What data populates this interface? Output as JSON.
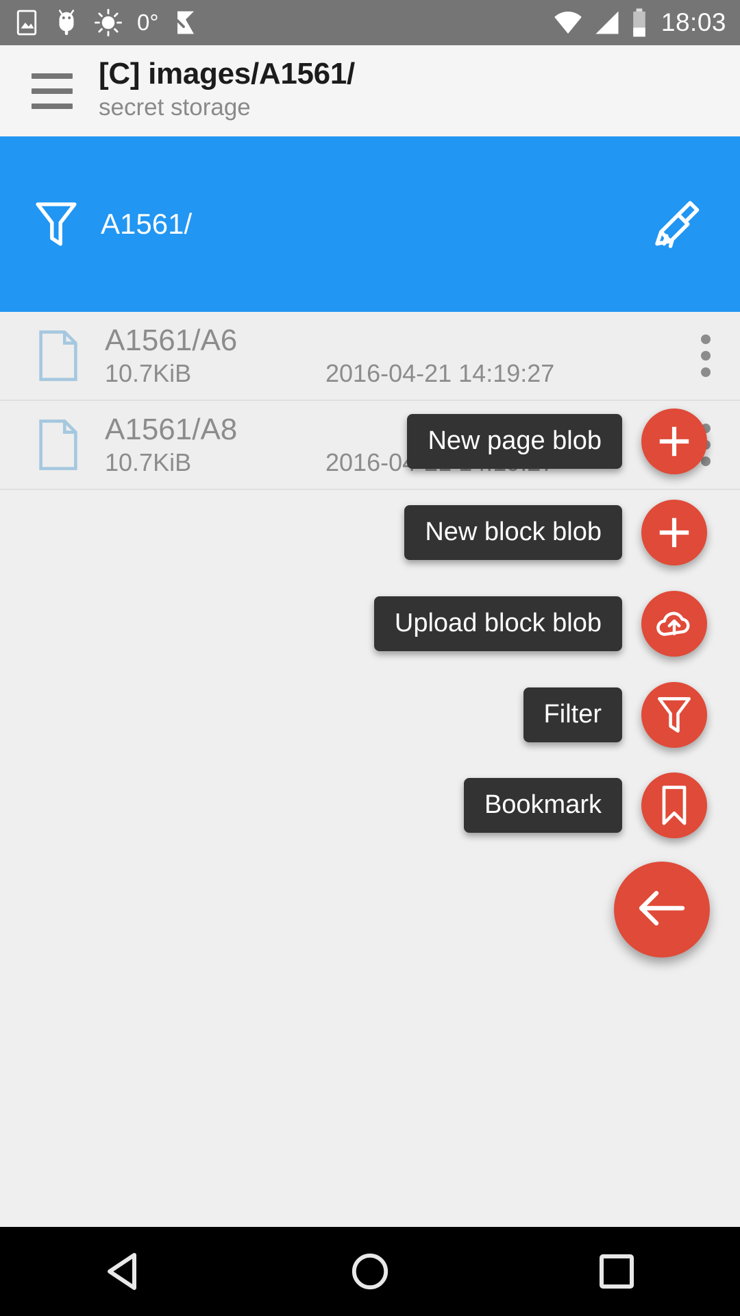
{
  "statusbar": {
    "temperature": "0°",
    "clock": "18:03",
    "icons": [
      "image-icon",
      "android-robot-icon",
      "brightness-icon",
      "checkmark-flag-icon",
      "wifi-icon",
      "signal-icon",
      "battery-icon"
    ]
  },
  "appbar": {
    "menu_icon": "hamburger-menu-icon",
    "title": "[C] images/A1561/",
    "subtitle": "secret storage"
  },
  "filterbar": {
    "filter_icon": "funnel-icon",
    "text": "A1561/",
    "clear_icon": "broom-icon",
    "color": "#2196f3"
  },
  "files": [
    {
      "name": "A1561/A6",
      "size": "10.7KiB",
      "date": "2016-04-21 14:19:27",
      "icon": "document-icon",
      "overflow_icon": "kebab-menu-icon"
    },
    {
      "name": "A1561/A8",
      "size": "10.7KiB",
      "date": "2016-04-21 14:19:27",
      "icon": "document-icon",
      "overflow_icon": "kebab-menu-icon"
    }
  ],
  "fab_menu": {
    "accent_color": "#e04a38",
    "items": [
      {
        "label": "New page blob",
        "icon": "plus-icon"
      },
      {
        "label": "New block blob",
        "icon": "plus-icon"
      },
      {
        "label": "Upload block blob",
        "icon": "cloud-upload-icon"
      },
      {
        "label": "Filter",
        "icon": "funnel-icon"
      },
      {
        "label": "Bookmark",
        "icon": "bookmark-icon"
      }
    ],
    "main": {
      "icon": "arrow-left-icon"
    }
  },
  "navbar": {
    "back": "triangle-back-icon",
    "home": "circle-home-icon",
    "recents": "square-recents-icon"
  }
}
